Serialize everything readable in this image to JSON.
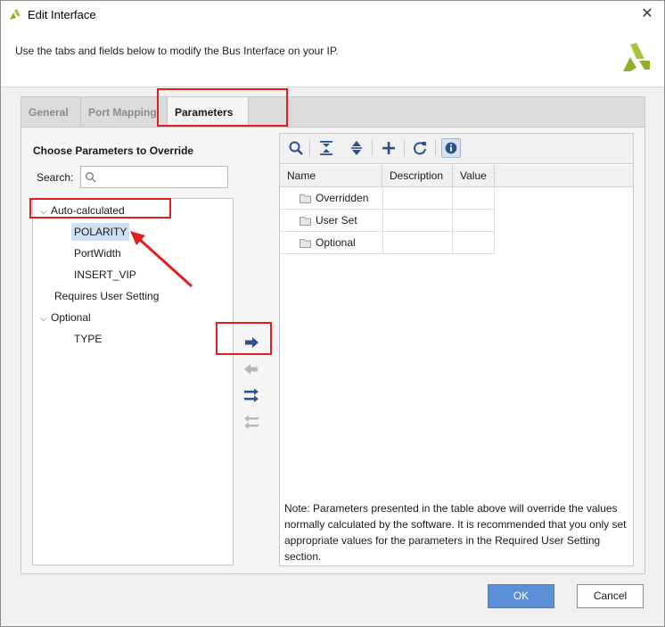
{
  "window": {
    "title": "Edit Interface",
    "close_symbol": "✕"
  },
  "header": {
    "description": "Use the tabs and fields below to modify the Bus Interface on your IP."
  },
  "tabs": [
    {
      "label": "General"
    },
    {
      "label": "Port Mapping"
    },
    {
      "label": "Parameters"
    }
  ],
  "left": {
    "title": "Choose Parameters to Override",
    "search_label": "Search:",
    "search_placeholder": "",
    "tree": {
      "auto_calculated": "Auto-calculated",
      "auto_children": [
        "POLARITY",
        "PortWidth",
        "INSERT_VIP"
      ],
      "requires_user_setting": "Requires User Setting",
      "optional": "Optional",
      "optional_children": [
        "TYPE"
      ]
    }
  },
  "table": {
    "columns": [
      "Name",
      "Description",
      "Value"
    ],
    "rows": [
      {
        "name": "Overridden",
        "description": "",
        "value": ""
      },
      {
        "name": "User Set",
        "description": "",
        "value": ""
      },
      {
        "name": "Optional",
        "description": "",
        "value": ""
      }
    ]
  },
  "note": "Note: Parameters presented in the table above will override the values normally calculated by the software. It is recommended that you only set appropriate values for the parameters in the Required User Setting section.",
  "buttons": {
    "ok": "OK",
    "cancel": "Cancel"
  },
  "colors": {
    "highlight": "#e02020",
    "accent": "#5b8fd6",
    "logo_green": "#8dae2b"
  }
}
